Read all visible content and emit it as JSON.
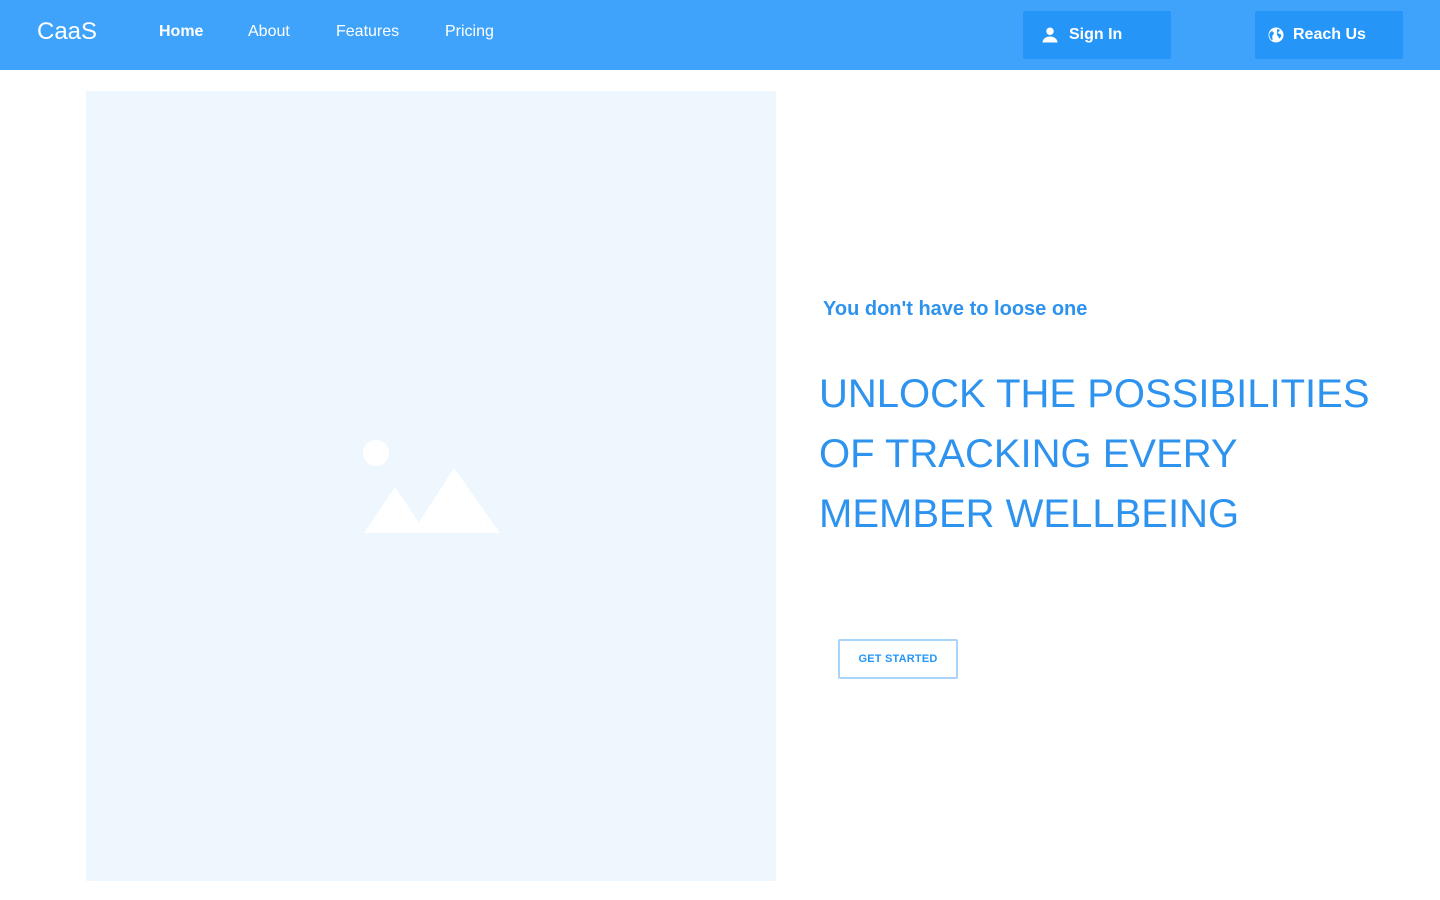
{
  "header": {
    "logo": "CaaS",
    "nav": [
      {
        "label": "Home",
        "active": true
      },
      {
        "label": "About",
        "active": false
      },
      {
        "label": "Features",
        "active": false
      },
      {
        "label": "Pricing",
        "active": false
      }
    ],
    "sign_in": {
      "label": "Sign In",
      "icon": "user-icon"
    },
    "reach_us": {
      "label": "Reach Us",
      "icon": "globe-icon"
    }
  },
  "hero": {
    "image": {
      "icon": "image-placeholder-icon"
    },
    "tagline": "You don't have to loose one",
    "headline": "UNLOCK THE POSSIBILITIES OF TRACKING EVERY MEMBER WELLBEING",
    "cta_label": "GET STARTED"
  },
  "colors": {
    "header_bg": "#3fa3fc",
    "button_bg": "#2596f8",
    "text_accent": "#2d93ef",
    "image_bg": "#eef7fe",
    "cta_border": "#a9d4fb"
  }
}
